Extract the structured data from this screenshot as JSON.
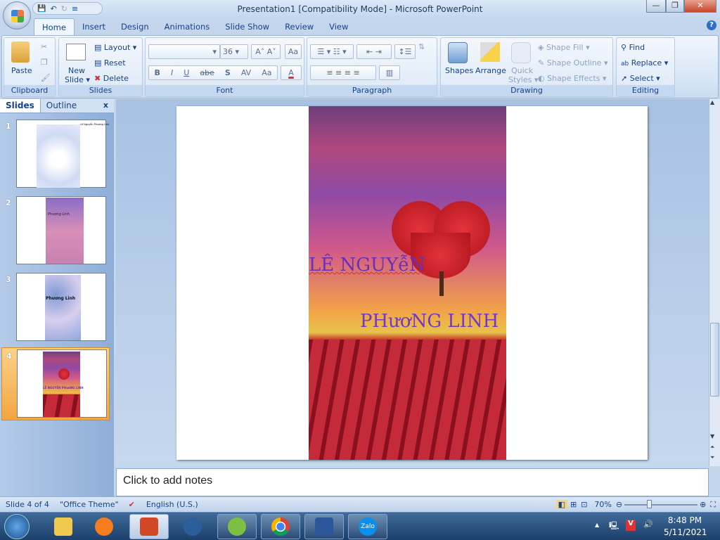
{
  "window": {
    "title": "Presentation1 [Compatibility Mode] - Microsoft PowerPoint",
    "minimize": "—",
    "restore": "❐",
    "close": "✕"
  },
  "qat": {
    "save": "💾",
    "undo": "↶",
    "redo": "↻",
    "customize": "≡"
  },
  "tabs": [
    "Home",
    "Insert",
    "Design",
    "Animations",
    "Slide Show",
    "Review",
    "View"
  ],
  "help": "?",
  "ribbon": {
    "clipboard": {
      "label": "Clipboard",
      "paste": "Paste"
    },
    "slides": {
      "label": "Slides",
      "new_slide_1": "New",
      "new_slide_2": "Slide ▾",
      "layout": "Layout ▾",
      "reset": "Reset",
      "delete": "Delete"
    },
    "font": {
      "label": "Font",
      "font_name": "",
      "font_size": "36",
      "grow": "A˄",
      "shrink": "A˅",
      "clear": "Aa",
      "bold": "B",
      "italic": "I",
      "underline": "U",
      "strike": "abe",
      "shadow": "S",
      "spacing": "AV",
      "case": "Aa",
      "color": "A"
    },
    "paragraph": {
      "label": "Paragraph"
    },
    "drawing": {
      "label": "Drawing",
      "shapes": "Shapes",
      "arrange": "Arrange",
      "quick_styles_1": "Quick",
      "quick_styles_2": "Styles ▾",
      "shape_fill": "Shape Fill ▾",
      "shape_outline": "Shape Outline ▾",
      "shape_effects": "Shape Effects ▾"
    },
    "editing": {
      "label": "Editing",
      "find": "Find",
      "replace": "Replace ▾",
      "select": "Select ▾"
    }
  },
  "pane": {
    "tab_slides": "Slides",
    "tab_outline": "Outline",
    "close": "x",
    "thumbs": [
      {
        "num": "1",
        "text": "Lê Nguyễn Phương Linh"
      },
      {
        "num": "2",
        "text": "Phương Linh"
      },
      {
        "num": "3",
        "text": "Phương Linh"
      },
      {
        "num": "4",
        "text": "LÊ NGUYỄN PHươNG LINH"
      }
    ]
  },
  "slide": {
    "line1": "LÊ NGUYễN",
    "line2": "PHươNG LINH"
  },
  "notes": {
    "placeholder": "Click to add notes"
  },
  "status": {
    "slide": "Slide 4 of 4",
    "theme": "\"Office Theme\"",
    "language": "English (U.S.)",
    "zoom": "70%",
    "zoom_percent": 70
  },
  "taskbar": {
    "time": "8:48 PM",
    "date": "5/11/2021",
    "zalo": "Zalo"
  }
}
